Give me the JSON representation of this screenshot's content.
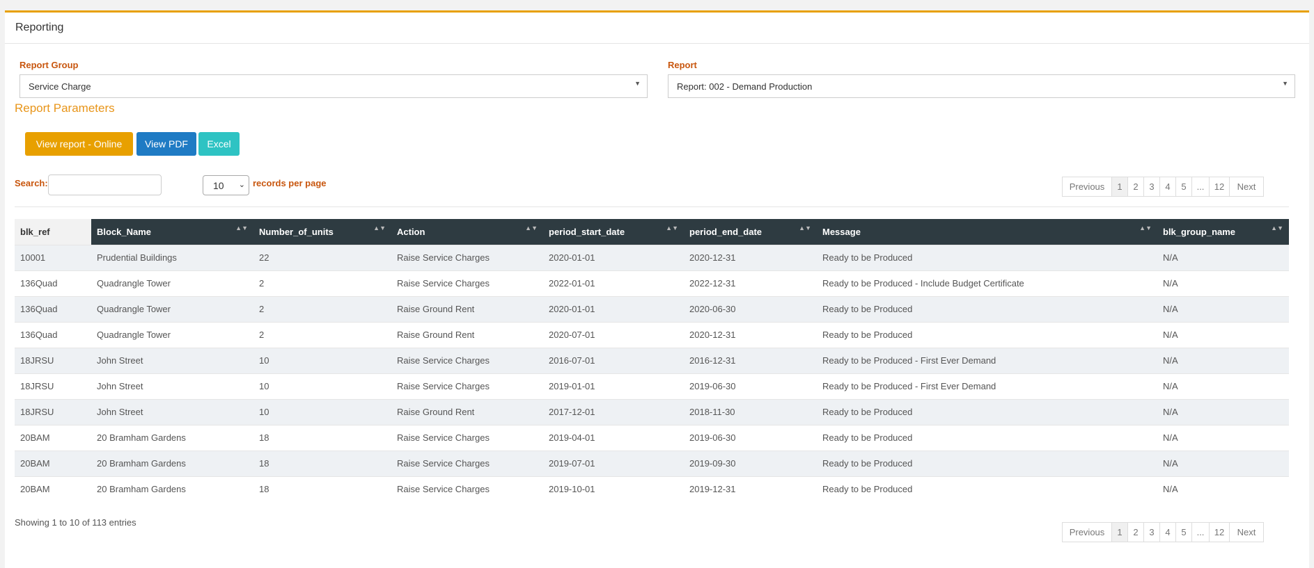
{
  "page": {
    "title": "Reporting"
  },
  "filters": {
    "report_group_label": "Report Group",
    "report_group_value": "Service Charge",
    "report_label": "Report",
    "report_value": "Report: 002 - Demand Production",
    "caret": "▼"
  },
  "parameters_title": "Report Parameters",
  "buttons": {
    "online": "View report - Online",
    "pdf": "View PDF",
    "excel": "Excel"
  },
  "toolbar": {
    "search_label": "Search:",
    "search_value": "",
    "page_length": "10",
    "page_length_chevron": "⌄",
    "records_label": "records per page"
  },
  "pagination": {
    "previous": "Previous",
    "next": "Next",
    "pages": [
      "1",
      "2",
      "3",
      "4",
      "5",
      "...",
      "12"
    ],
    "active_page": "1"
  },
  "table": {
    "columns": [
      "blk_ref",
      "Block_Name",
      "Number_of_units",
      "Action",
      "period_start_date",
      "period_end_date",
      "Message",
      "blk_group_name"
    ],
    "sort_glyph": "▲▼",
    "rows": [
      [
        "10001",
        "Prudential Buildings",
        "22",
        "Raise Service Charges",
        "2020-01-01",
        "2020-12-31",
        "Ready to be Produced",
        "N/A"
      ],
      [
        "136Quad",
        "Quadrangle Tower",
        "2",
        "Raise Service Charges",
        "2022-01-01",
        "2022-12-31",
        "Ready to be Produced - Include Budget Certificate",
        "N/A"
      ],
      [
        "136Quad",
        "Quadrangle Tower",
        "2",
        "Raise Ground Rent",
        "2020-01-01",
        "2020-06-30",
        "Ready to be Produced",
        "N/A"
      ],
      [
        "136Quad",
        "Quadrangle Tower",
        "2",
        "Raise Ground Rent",
        "2020-07-01",
        "2020-12-31",
        "Ready to be Produced",
        "N/A"
      ],
      [
        "18JRSU",
        "John Street",
        "10",
        "Raise Service Charges",
        "2016-07-01",
        "2016-12-31",
        "Ready to be Produced - First Ever Demand",
        "N/A"
      ],
      [
        "18JRSU",
        "John Street",
        "10",
        "Raise Service Charges",
        "2019-01-01",
        "2019-06-30",
        "Ready to be Produced - First Ever Demand",
        "N/A"
      ],
      [
        "18JRSU",
        "John Street",
        "10",
        "Raise Ground Rent",
        "2017-12-01",
        "2018-11-30",
        "Ready to be Produced",
        "N/A"
      ],
      [
        "20BAM",
        "20 Bramham Gardens",
        "18",
        "Raise Service Charges",
        "2019-04-01",
        "2019-06-30",
        "Ready to be Produced",
        "N/A"
      ],
      [
        "20BAM",
        "20 Bramham Gardens",
        "18",
        "Raise Service Charges",
        "2019-07-01",
        "2019-09-30",
        "Ready to be Produced",
        "N/A"
      ],
      [
        "20BAM",
        "20 Bramham Gardens",
        "18",
        "Raise Service Charges",
        "2019-10-01",
        "2019-12-31",
        "Ready to be Produced",
        "N/A"
      ]
    ]
  },
  "info": "Showing 1 to 10 of 113 entries",
  "colors": {
    "accent": "#e8a000",
    "label": "#c8560e",
    "header": "#2e3b41",
    "pdf": "#1f7bc4",
    "excel": "#2ec3c3"
  }
}
